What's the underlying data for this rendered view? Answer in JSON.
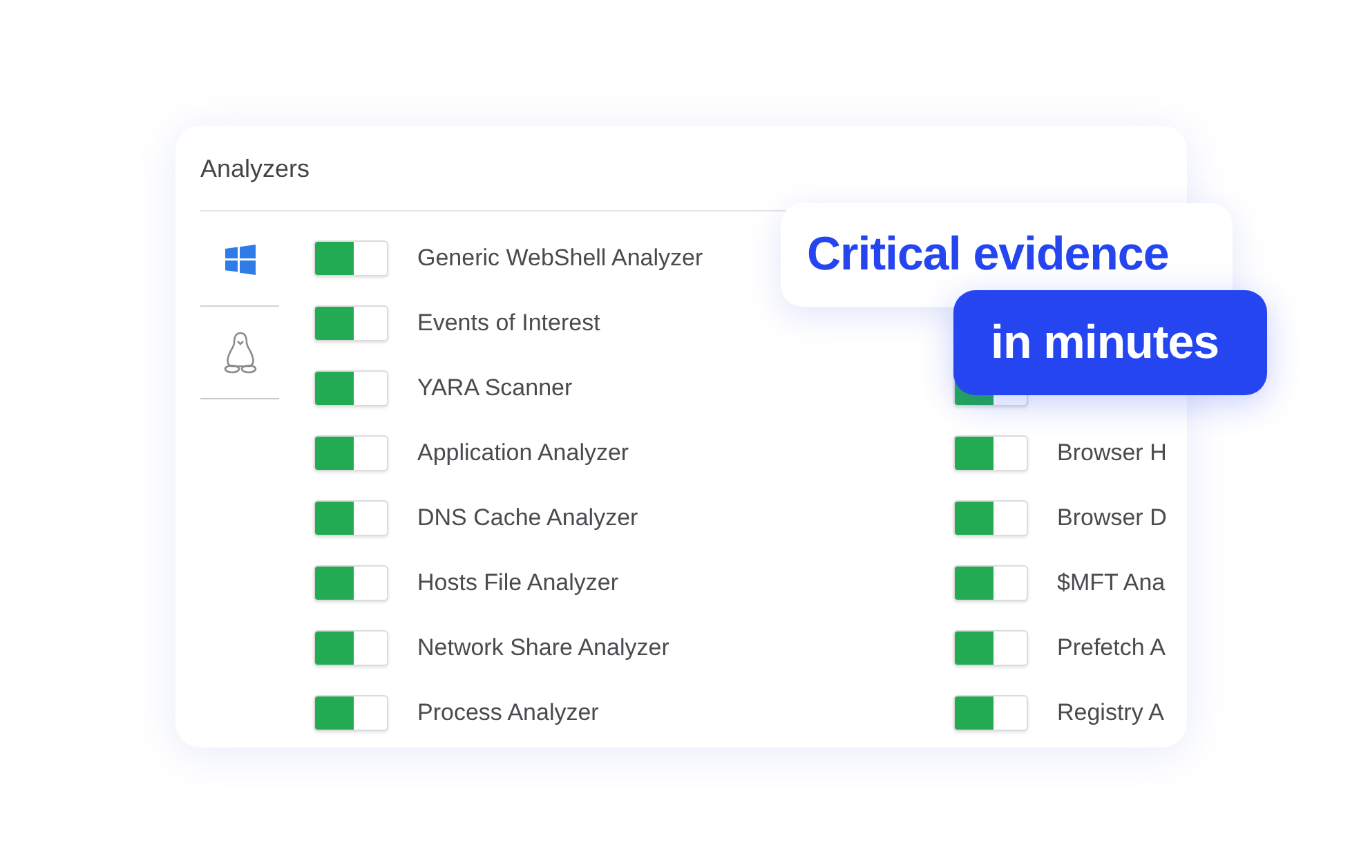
{
  "panel": {
    "title": "Analyzers",
    "os_tabs": [
      {
        "kind": "windows",
        "selected": true
      },
      {
        "kind": "linux",
        "selected": false
      }
    ],
    "left_column": [
      {
        "label": "Generic WebShell Analyzer",
        "on": true
      },
      {
        "label": "Events of Interest",
        "on": true
      },
      {
        "label": "YARA Scanner",
        "on": true
      },
      {
        "label": "Application Analyzer",
        "on": true
      },
      {
        "label": "DNS Cache Analyzer",
        "on": true
      },
      {
        "label": "Hosts File Analyzer",
        "on": true
      },
      {
        "label": "Network Share Analyzer",
        "on": true
      },
      {
        "label": "Process Analyzer",
        "on": true
      }
    ],
    "right_column": [
      {
        "on": true
      },
      {
        "label": "Browser H",
        "on": true
      },
      {
        "label": "Browser D",
        "on": true
      },
      {
        "label": "$MFT Ana",
        "on": true
      },
      {
        "label": "Prefetch A",
        "on": true
      },
      {
        "label": "Registry A",
        "on": true
      }
    ]
  },
  "callouts": [
    {
      "kind": "light",
      "text": "Critical evidence"
    },
    {
      "kind": "dark",
      "text": "in minutes"
    }
  ]
}
